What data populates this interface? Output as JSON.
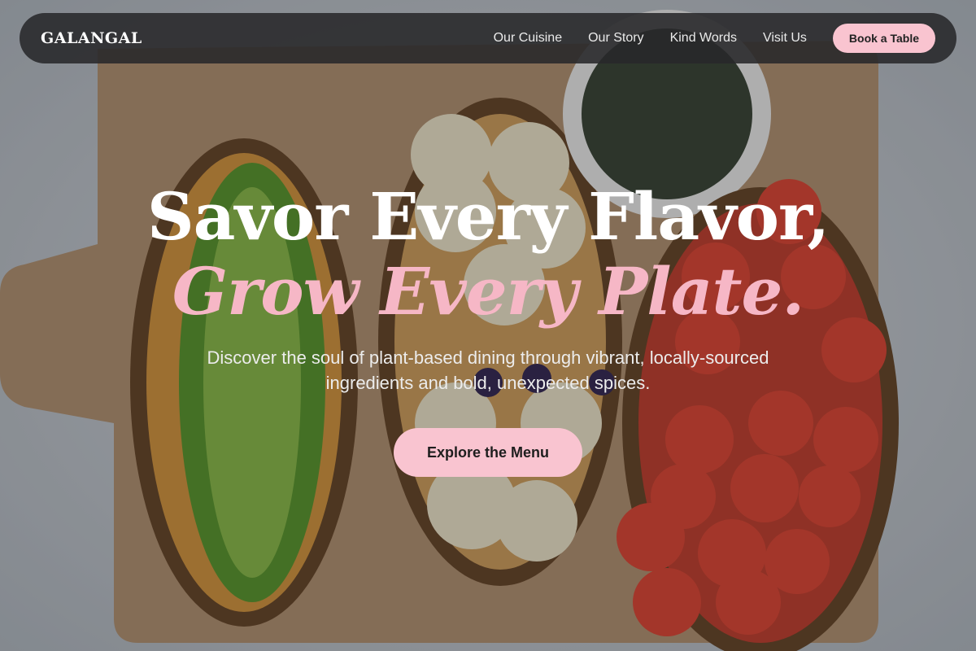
{
  "nav": {
    "logo": "GALANGAL",
    "links": [
      "Our Cuisine",
      "Our Story",
      "Kind Words",
      "Visit Us"
    ],
    "cta": "Book a Table"
  },
  "hero": {
    "line1": "Savor Every Flavor,",
    "line2": "Grow Every Plate.",
    "subtitle": "Discover the soul of plant-based dining through vibrant, locally-sourced ingredients and bold, unexpected spices.",
    "cta": "Explore the Menu"
  },
  "colors": {
    "accent_pink": "#f9c4d0",
    "headline_pink": "#f6b7c6",
    "nav_bg": "#28282a"
  }
}
